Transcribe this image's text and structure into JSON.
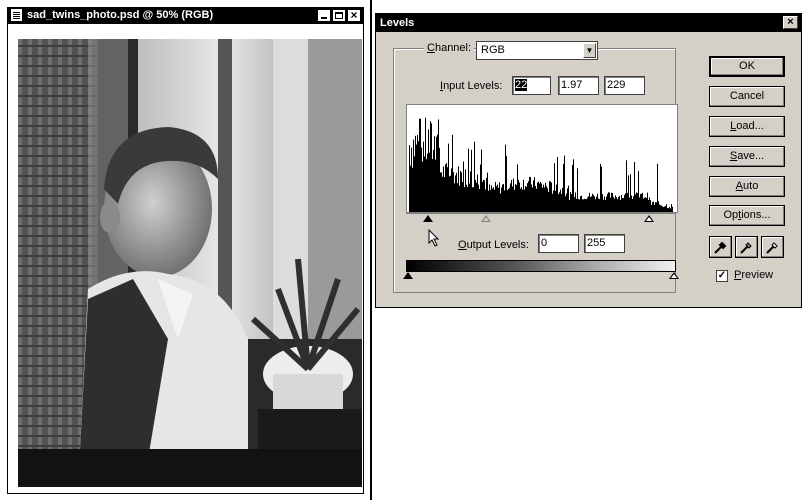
{
  "document_window": {
    "title": "sad_twins_photo.psd @ 50% (RGB)",
    "icons": [
      "document-icon",
      "minimize-icon",
      "maximize-icon",
      "close-icon"
    ]
  },
  "levels_dialog": {
    "title": "Levels",
    "close_glyph": "×",
    "channel": {
      "label_prefix": "",
      "label_ul": "C",
      "label_rest": "hannel:",
      "value": "RGB"
    },
    "input_levels": {
      "label_ul": "I",
      "label_rest": "nput Levels:",
      "black": "22",
      "gamma": "1.97",
      "white": "229"
    },
    "output_levels": {
      "label_ul": "O",
      "label_rest": "utput Levels:",
      "black": "0",
      "white": "255"
    },
    "buttons": {
      "ok": "OK",
      "cancel": "Cancel",
      "load_ul": "L",
      "load_rest": "oad...",
      "save_ul": "S",
      "save_rest": "ave...",
      "auto_ul": "A",
      "auto_rest": "uto",
      "options_pre": "Op",
      "options_ul": "t",
      "options_rest": "ions..."
    },
    "droppers": [
      "black-eyedropper-icon",
      "gray-eyedropper-icon",
      "white-eyedropper-icon"
    ],
    "preview": {
      "checked": true,
      "check_glyph": "✓",
      "label_ul": "P",
      "label_rest": "review"
    },
    "histogram": {
      "input_black": 22,
      "input_gamma": 1.97,
      "input_white": 229
    }
  }
}
